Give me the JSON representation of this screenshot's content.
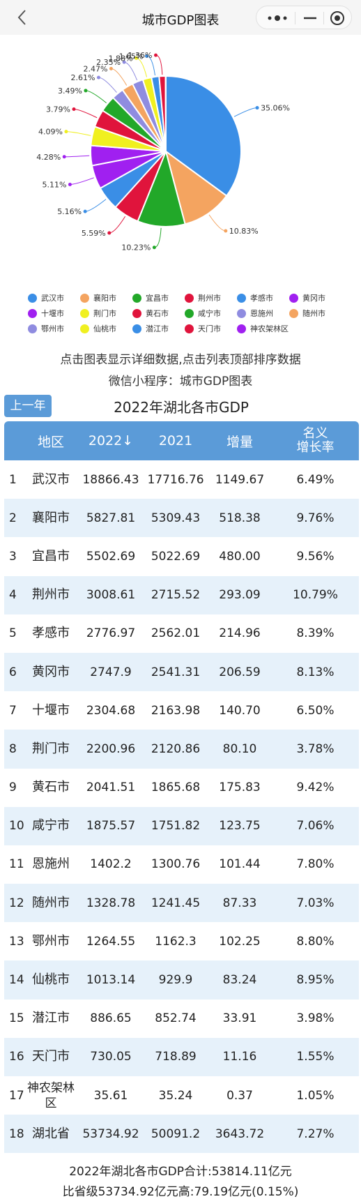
{
  "nav": {
    "title": "城市GDP图表"
  },
  "chart_data": {
    "type": "pie",
    "slices": [
      {
        "name": "武汉市",
        "value": 35.06,
        "label": "35.06%",
        "color": "#3a8ee6"
      },
      {
        "name": "襄阳市",
        "value": 10.83,
        "label": "10.83%",
        "color": "#f4a460"
      },
      {
        "name": "宜昌市",
        "value": 10.23,
        "label": "10.23%",
        "color": "#22a829"
      },
      {
        "name": "荆州市",
        "value": 5.59,
        "label": "5.59%",
        "color": "#e0143c"
      },
      {
        "name": "孝感市",
        "value": 5.16,
        "label": "5.16%",
        "color": "#3a8ee6"
      },
      {
        "name": "黄冈市",
        "value": 5.11,
        "label": "5.11%",
        "color": "#a020f0"
      },
      {
        "name": "十堰市",
        "value": 4.28,
        "label": "4.28%",
        "color": "#a020f0"
      },
      {
        "name": "荆门市",
        "value": 4.09,
        "label": "4.09%",
        "color": "#f0f020"
      },
      {
        "name": "黄石市",
        "value": 3.79,
        "label": "3.79%",
        "color": "#e0143c"
      },
      {
        "name": "咸宁市",
        "value": 3.49,
        "label": "3.49%",
        "color": "#22a829"
      },
      {
        "name": "恩施州",
        "value": 2.61,
        "label": "2.61%",
        "color": "#8f8ce0"
      },
      {
        "name": "随州市",
        "value": 2.47,
        "label": "2.47%",
        "color": "#f4a460"
      },
      {
        "name": "鄂州市",
        "value": 2.35,
        "label": "2.35%",
        "color": "#8f8ce0"
      },
      {
        "name": "仙桃市",
        "value": 1.88,
        "label": "1.88%",
        "color": "#f0f020"
      },
      {
        "name": "潜江市",
        "value": 1.65,
        "label": "1.65%",
        "color": "#3a8ee6"
      },
      {
        "name": "天门市",
        "value": 1.36,
        "label": "1.36%",
        "color": "#e0143c"
      },
      {
        "name": "神农架林区",
        "value": 0.07,
        "label": "",
        "color": "#a020f0"
      }
    ]
  },
  "info": {
    "line1": "点击图表显示详细数据,点击列表顶部排序数据",
    "line2": "微信小程序：城市GDP图表"
  },
  "table": {
    "prev_label": "上一年",
    "title": "2022年湖北各市GDP",
    "headers": {
      "region": "地区",
      "y2022": "2022↓",
      "y2021": "2021",
      "increase": "增量",
      "growth_l1": "名义",
      "growth_l2": "增长率"
    },
    "rows": [
      {
        "idx": "1",
        "name": "武汉市",
        "v2022": "18866.43",
        "v2021": "17716.76",
        "inc": "1149.67",
        "rate": "6.49%"
      },
      {
        "idx": "2",
        "name": "襄阳市",
        "v2022": "5827.81",
        "v2021": "5309.43",
        "inc": "518.38",
        "rate": "9.76%"
      },
      {
        "idx": "3",
        "name": "宜昌市",
        "v2022": "5502.69",
        "v2021": "5022.69",
        "inc": "480.00",
        "rate": "9.56%"
      },
      {
        "idx": "4",
        "name": "荆州市",
        "v2022": "3008.61",
        "v2021": "2715.52",
        "inc": "293.09",
        "rate": "10.79%"
      },
      {
        "idx": "5",
        "name": "孝感市",
        "v2022": "2776.97",
        "v2021": "2562.01",
        "inc": "214.96",
        "rate": "8.39%"
      },
      {
        "idx": "6",
        "name": "黄冈市",
        "v2022": "2747.9",
        "v2021": "2541.31",
        "inc": "206.59",
        "rate": "8.13%"
      },
      {
        "idx": "7",
        "name": "十堰市",
        "v2022": "2304.68",
        "v2021": "2163.98",
        "inc": "140.70",
        "rate": "6.50%"
      },
      {
        "idx": "8",
        "name": "荆门市",
        "v2022": "2200.96",
        "v2021": "2120.86",
        "inc": "80.10",
        "rate": "3.78%"
      },
      {
        "idx": "9",
        "name": "黄石市",
        "v2022": "2041.51",
        "v2021": "1865.68",
        "inc": "175.83",
        "rate": "9.42%"
      },
      {
        "idx": "10",
        "name": "咸宁市",
        "v2022": "1875.57",
        "v2021": "1751.82",
        "inc": "123.75",
        "rate": "7.06%"
      },
      {
        "idx": "11",
        "name": "恩施州",
        "v2022": "1402.2",
        "v2021": "1300.76",
        "inc": "101.44",
        "rate": "7.80%"
      },
      {
        "idx": "12",
        "name": "随州市",
        "v2022": "1328.78",
        "v2021": "1241.45",
        "inc": "87.33",
        "rate": "7.03%"
      },
      {
        "idx": "13",
        "name": "鄂州市",
        "v2022": "1264.55",
        "v2021": "1162.3",
        "inc": "102.25",
        "rate": "8.80%"
      },
      {
        "idx": "14",
        "name": "仙桃市",
        "v2022": "1013.14",
        "v2021": "929.9",
        "inc": "83.24",
        "rate": "8.95%"
      },
      {
        "idx": "15",
        "name": "潜江市",
        "v2022": "886.65",
        "v2021": "852.74",
        "inc": "33.91",
        "rate": "3.98%"
      },
      {
        "idx": "16",
        "name": "天门市",
        "v2022": "730.05",
        "v2021": "718.89",
        "inc": "11.16",
        "rate": "1.55%"
      },
      {
        "idx": "17",
        "name": "神农架林区",
        "v2022": "35.61",
        "v2021": "35.24",
        "inc": "0.37",
        "rate": "1.05%"
      },
      {
        "idx": "18",
        "name": "湖北省",
        "v2022": "53734.92",
        "v2021": "50091.2",
        "inc": "3643.72",
        "rate": "7.27%"
      }
    ]
  },
  "footer": {
    "line1": "2022年湖北各市GDP合计:53814.11亿元",
    "line2": "比省级53734.92亿元高:79.19亿元(0.15%)"
  }
}
